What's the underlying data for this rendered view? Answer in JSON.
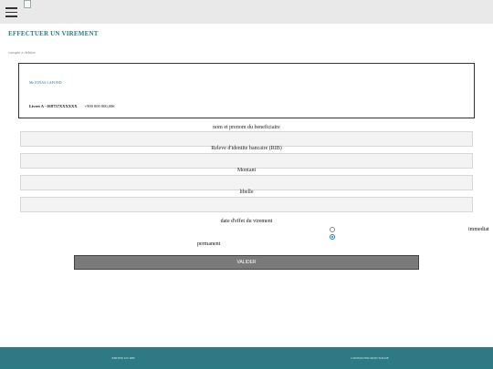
{
  "header": {
    "menu_icon": "hamburger-icon",
    "logo_icon": "broken-image-icon"
  },
  "page": {
    "title": "EFFECTUER UN VIREMENT",
    "account_label": "compte a debiter"
  },
  "account": {
    "holder": "Mr JONAS LAFOND",
    "name": "Livret A - 018757XXXXXX",
    "balance": "+900 000 000,00€"
  },
  "form": {
    "beneficiary_label": "nom et prenom du beneficiaire",
    "beneficiary_value": "",
    "rib_label": "Releve d'identite bancaire (RIB)",
    "rib_value": "",
    "amount_label": "Montant",
    "amount_value": "",
    "libelle_label": "libelle",
    "libelle_value": "",
    "date_label": "date d'effet du virement",
    "option_immediat": "immediat",
    "option_permanent": "permanent",
    "selected_option": "permanent",
    "submit_label": "VALIDER"
  },
  "bottom_nav": {
    "left_label": "EDITER UN RIB",
    "right_label": "CONSULTER MON SOLDE"
  },
  "colors": {
    "accent": "#2d7a8a",
    "bottom_bar": "#2e7a84",
    "button": "#7a7a7a"
  }
}
